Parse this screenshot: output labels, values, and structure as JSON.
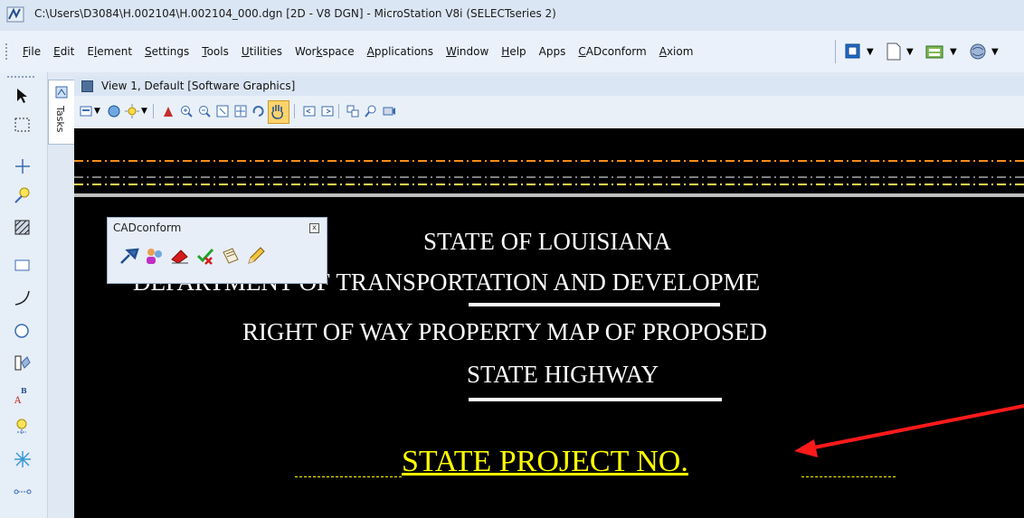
{
  "window": {
    "title": "C:\\Users\\D3084\\H.002104\\H.002104_000.dgn [2D - V8 DGN] - MicroStation V8i (SELECTseries 2)"
  },
  "menu": {
    "items": [
      {
        "ul": "F",
        "rest": "ile"
      },
      {
        "ul": "E",
        "rest": "dit"
      },
      {
        "pre": "E",
        "ul": "l",
        "rest": "ement"
      },
      {
        "ul": "S",
        "rest": "ettings"
      },
      {
        "ul": "T",
        "rest": "ools"
      },
      {
        "ul": "U",
        "rest": "tilities"
      },
      {
        "pre": "Wor",
        "ul": "k",
        "rest": "space"
      },
      {
        "ul": "A",
        "rest": "pplications"
      },
      {
        "ul": "W",
        "rest": "indow"
      },
      {
        "ul": "H",
        "rest": "elp"
      },
      {
        "pre": "Apps",
        "ul": "",
        "rest": ""
      },
      {
        "ul": "C",
        "rest": "ADconform"
      },
      {
        "ul": "A",
        "rest": "xiom"
      }
    ]
  },
  "tasks": {
    "label": "Tasks"
  },
  "view": {
    "title": "View 1, Default [Software Graphics]"
  },
  "cadconform": {
    "title": "CADconform",
    "close": "x"
  },
  "drawing": {
    "line1": "STATE  OF  LOUISIANA",
    "line2": "DEPARTMENT  OF  TRANSPORTATION  AND  DEVELOPME",
    "line3": "RIGHT OF WAY PROPERTY MAP OF PROPOSED",
    "line4": "STATE HIGHWAY",
    "project": "STATE PROJECT  NO."
  },
  "colors": {
    "canvas": "#000000",
    "drawing_text": "#ffffff",
    "project_text": "#ffff00",
    "arrow": "#ff1a1a",
    "orange_line": "#ff8c1a"
  }
}
